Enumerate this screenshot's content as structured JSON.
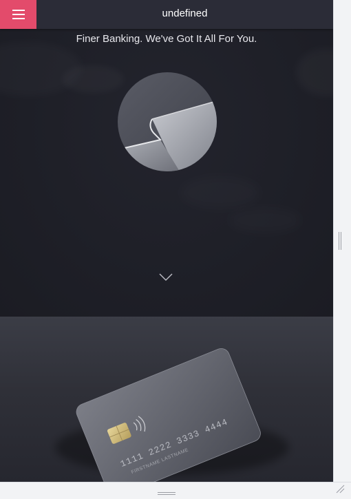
{
  "header": {
    "title": "undefined",
    "menu_icon": "hamburger-menu-icon"
  },
  "hero": {
    "tagline": "Finer Banking. We've Got It All For You.",
    "image": "card-edge-closeup-image",
    "scroll_icon": "chevron-down-icon"
  },
  "card": {
    "number": "1111 2222 3333 4444",
    "name": "FIRSTNAME LASTNAME",
    "chip_icon": "chip-icon",
    "contactless_icon": "contactless-icon"
  },
  "colors": {
    "accent": "#e34b6b",
    "header_bg": "#2b2c37",
    "page_bg": "#1f2028"
  }
}
